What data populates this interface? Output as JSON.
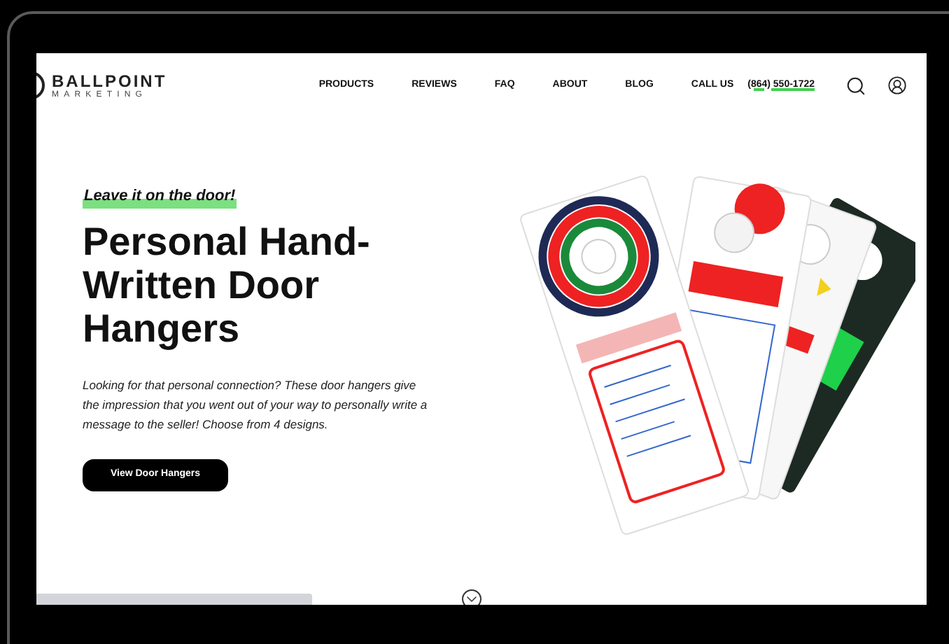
{
  "header": {
    "logo_main": "BALLPOINT",
    "logo_sub": "MARKETING",
    "nav": [
      "PRODUCTS",
      "REVIEWS",
      "FAQ",
      "ABOUT",
      "BLOG",
      "CALL US"
    ],
    "phone": "(864) 550-1722"
  },
  "hero": {
    "tagline": "Leave it on the door!",
    "title": "Personal Hand-Written Door Hangers",
    "description": "Looking for that personal connection? These door hangers give the impression that you went out of your way to personally write a message to the seller! Choose from 4 designs.",
    "button": "View Door Hangers"
  }
}
